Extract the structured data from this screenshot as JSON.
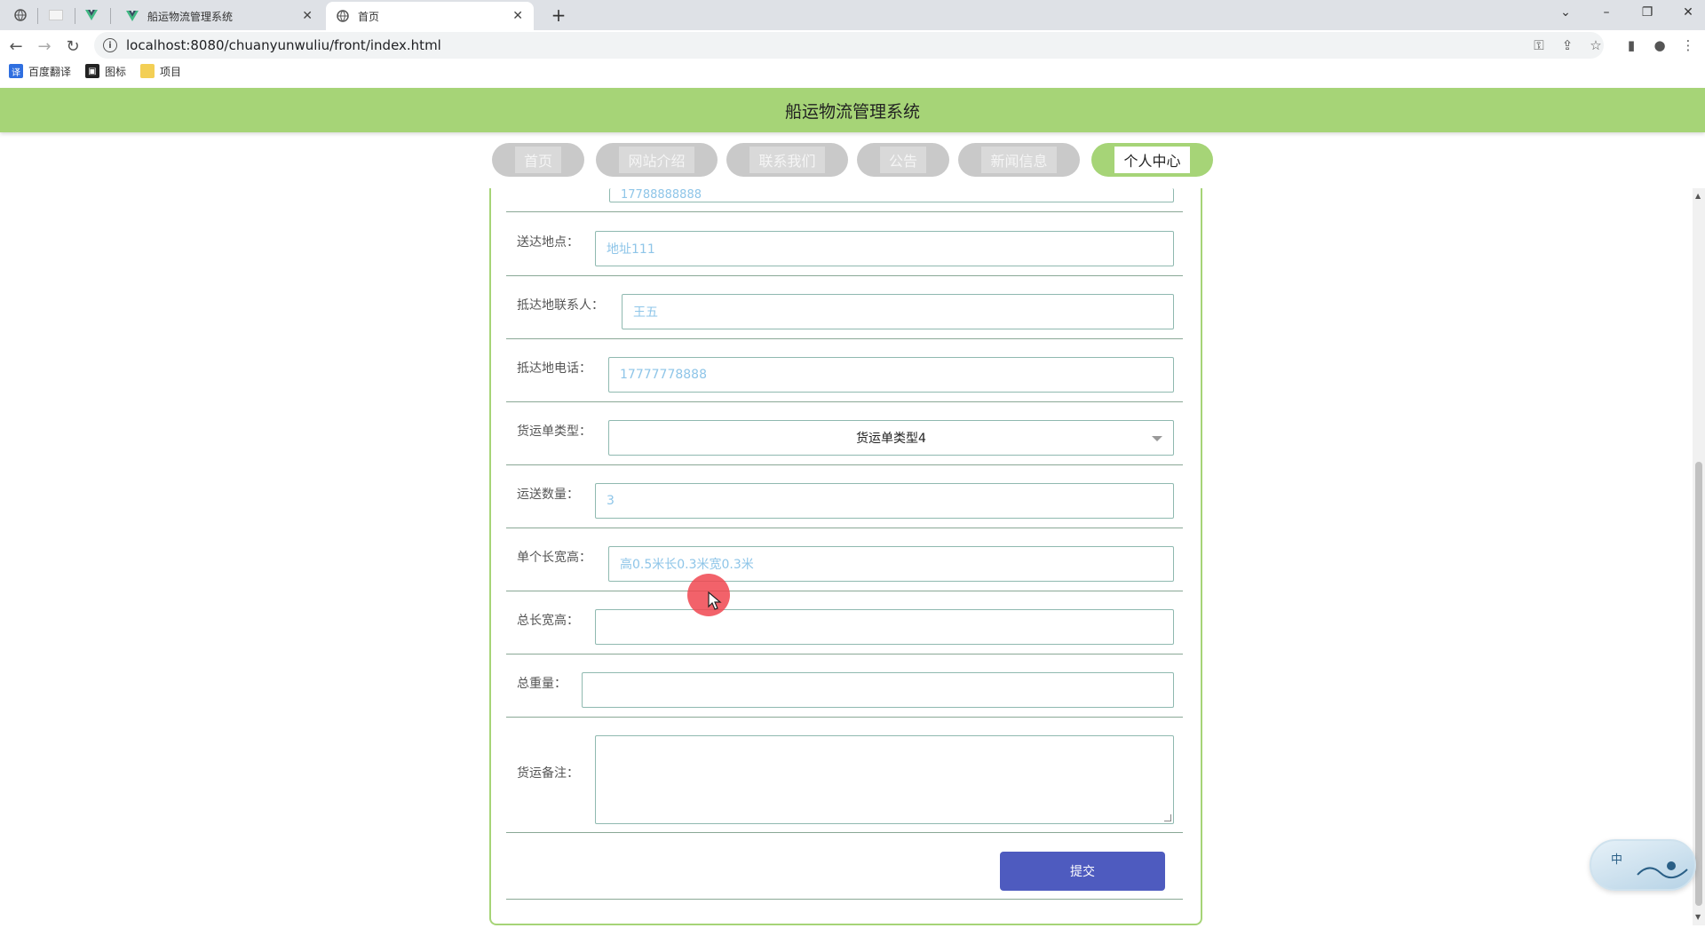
{
  "browser": {
    "tabs": [
      {
        "title": "船运物流管理系统",
        "active": false
      },
      {
        "title": "首页",
        "active": true
      }
    ],
    "url": "localhost:8080/chuanyunwuliu/front/index.html",
    "bookmarks": [
      "百度翻译",
      "图标",
      "项目"
    ]
  },
  "site": {
    "title": "船运物流管理系统",
    "nav": [
      "首页",
      "网站介绍",
      "联系我们",
      "公告",
      "新闻信息",
      "个人中心"
    ],
    "active_nav": "个人中心"
  },
  "form": {
    "top_partial_value": "17788888888",
    "fields": [
      {
        "label": "送达地点：",
        "value": "地址111"
      },
      {
        "label": "抵达地联系人：",
        "value": "王五"
      },
      {
        "label": "抵达地电话：",
        "value": "17777778888"
      },
      {
        "label": "货运单类型：",
        "value": "货运单类型4"
      },
      {
        "label": "运送数量：",
        "value": "3"
      },
      {
        "label": "单个长宽高：",
        "value": "高0.5米长0.3米宽0.3米"
      },
      {
        "label": "总长宽高：",
        "value": ""
      },
      {
        "label": "总重量：",
        "value": ""
      },
      {
        "label": "货运备注：",
        "value": ""
      }
    ],
    "submit_label": "提交"
  },
  "widget": {
    "label": "中"
  },
  "colors": {
    "header": "#a6d477",
    "submit": "#4e5bbf",
    "input_text": "#8ec5e8"
  }
}
